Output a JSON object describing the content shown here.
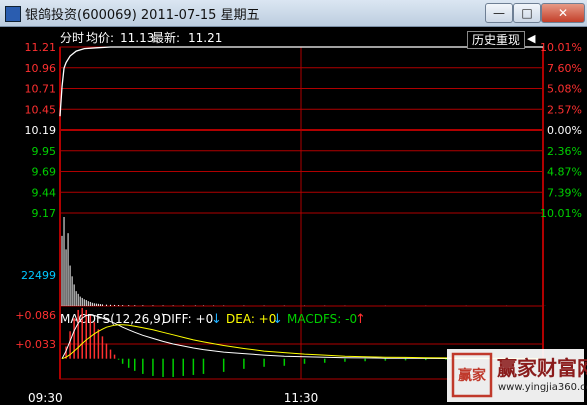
{
  "window": {
    "title": "银鸽投资(600069) 2011-07-15 星期五",
    "min_label": "—",
    "max_label": "□",
    "close_label": "✕"
  },
  "header": {
    "label_fenshi": "分时",
    "label_avg": "均价:",
    "avg_value": "11.13",
    "label_last": "最新:",
    "last_value": "11.21",
    "replay_label": "历史重现",
    "replay_icon": "play-back-icon"
  },
  "chart_data": [
    {
      "type": "line",
      "title": "分时",
      "prev_close": 10.19,
      "price_ticks": [
        "11.21",
        "10.96",
        "10.71",
        "10.45",
        "10.19",
        "9.95",
        "9.69",
        "9.44",
        "9.17"
      ],
      "pct_ticks": [
        "10.01%",
        "7.60%",
        "5.08%",
        "2.57%",
        "0.00%",
        "2.36%",
        "4.87%",
        "7.39%",
        "10.01%"
      ],
      "ylim": [
        9.17,
        11.21
      ],
      "x_ticks": [
        "09:30",
        "11:30"
      ],
      "colors": {
        "price": "#ffffff",
        "avg": "#ffff00",
        "up": "#ff3030",
        "down": "#00d000",
        "flat": "#ffffff",
        "grid": "#b00000"
      },
      "series": [
        {
          "values": [
            [
              0,
              10.36
            ],
            [
              1,
              10.72
            ],
            [
              2,
              10.95
            ],
            [
              3,
              11.02
            ],
            [
              5,
              11.1
            ],
            [
              8,
              11.16
            ],
            [
              12,
              11.19
            ],
            [
              18,
              11.2
            ],
            [
              25,
              11.21
            ],
            [
              40,
              11.21
            ],
            [
              65,
              11.21
            ],
            [
              100,
              11.21
            ],
            [
              120,
              11.21
            ],
            [
              150,
              11.21
            ],
            [
              200,
              11.21
            ],
            [
              239,
              11.21
            ]
          ]
        }
      ]
    },
    {
      "type": "bar",
      "title": "成交量",
      "y_tick": "22499",
      "ylim": [
        0,
        33000
      ],
      "color": "#ffffff",
      "x": [
        0,
        1,
        2,
        3,
        4,
        5,
        6,
        7,
        8,
        9,
        10,
        11,
        12,
        13,
        14,
        15,
        16,
        17,
        18,
        19,
        20,
        22,
        24,
        26,
        28,
        30,
        33,
        36,
        40,
        45,
        50,
        55,
        60,
        66,
        70,
        75,
        80,
        90,
        100,
        110,
        120,
        130,
        140,
        160,
        180,
        200,
        220,
        239
      ],
      "values": [
        26000,
        33000,
        21000,
        27000,
        15000,
        11000,
        8000,
        5500,
        4500,
        3500,
        3000,
        2500,
        2200,
        1800,
        1500,
        1200,
        1000,
        900,
        800,
        700,
        600,
        500,
        450,
        400,
        350,
        300,
        280,
        260,
        250,
        220,
        200,
        180,
        180,
        160,
        150,
        140,
        130,
        120,
        110,
        100,
        90,
        80,
        70,
        60,
        55,
        50,
        45,
        40
      ]
    },
    {
      "type": "bar",
      "title": "MACDFS(12,26,9)",
      "indicator": {
        "label": "MACDFS(12,26,9)",
        "diff_label": "DIFF: +0",
        "dea_label": "DEA: +0",
        "macdfs_label": "MACDFS: -0",
        "diff_arrow": "down",
        "dea_arrow": "down",
        "macdfs_arrow": "up",
        "diff_color": "#ffffff",
        "dea_color": "#ffff00",
        "macdfs_color": "#00d000",
        "down_arrow_color": "#20b0ff",
        "up_arrow_color": "#ff3030"
      },
      "y_ticks": [
        "+0.086",
        "+0.033"
      ],
      "ylim": [
        -0.04,
        0.09
      ],
      "x": [
        0,
        2,
        4,
        6,
        8,
        10,
        12,
        14,
        16,
        18,
        20,
        22,
        24,
        26,
        28,
        30,
        33,
        36,
        40,
        45,
        50,
        55,
        60,
        65,
        70,
        80,
        90,
        100,
        110,
        120,
        130,
        140,
        150,
        160,
        170,
        180,
        190,
        200,
        210,
        220,
        230,
        239
      ],
      "diff": [
        0.0,
        0.015,
        0.035,
        0.055,
        0.07,
        0.08,
        0.085,
        0.086,
        0.085,
        0.083,
        0.08,
        0.077,
        0.073,
        0.07,
        0.066,
        0.062,
        0.057,
        0.052,
        0.046,
        0.04,
        0.034,
        0.029,
        0.025,
        0.021,
        0.018,
        0.013,
        0.01,
        0.007,
        0.005,
        0.004,
        0.003,
        0.002,
        0.0015,
        0.001,
        0.0008,
        0.0006,
        0.0004,
        0.0003,
        0.0002,
        0.0001,
        0.0,
        0.0
      ],
      "dea": [
        0.0,
        0.003,
        0.008,
        0.015,
        0.022,
        0.03,
        0.037,
        0.043,
        0.049,
        0.054,
        0.058,
        0.062,
        0.064,
        0.066,
        0.067,
        0.067,
        0.066,
        0.064,
        0.061,
        0.057,
        0.052,
        0.047,
        0.042,
        0.037,
        0.033,
        0.026,
        0.02,
        0.015,
        0.012,
        0.009,
        0.007,
        0.005,
        0.004,
        0.003,
        0.0025,
        0.002,
        0.0015,
        0.001,
        0.0008,
        0.0005,
        0.0002,
        0.0
      ],
      "hist": [
        0.0,
        0.024,
        0.054,
        0.08,
        0.096,
        0.1,
        0.096,
        0.086,
        0.072,
        0.058,
        0.044,
        0.03,
        0.018,
        0.008,
        -0.002,
        -0.01,
        -0.018,
        -0.024,
        -0.03,
        -0.034,
        -0.036,
        -0.036,
        -0.034,
        -0.032,
        -0.03,
        -0.026,
        -0.02,
        -0.016,
        -0.014,
        -0.01,
        -0.008,
        -0.006,
        -0.005,
        -0.004,
        -0.0034,
        -0.0028,
        -0.0022,
        -0.0014,
        -0.0012,
        -0.0008,
        -0.0004,
        0.0
      ]
    }
  ],
  "watermark": {
    "name": "赢家财富网",
    "url": "www.yingjia360.com",
    "seal_text": "赢家",
    "seal_icon": "seal-logo-icon"
  }
}
